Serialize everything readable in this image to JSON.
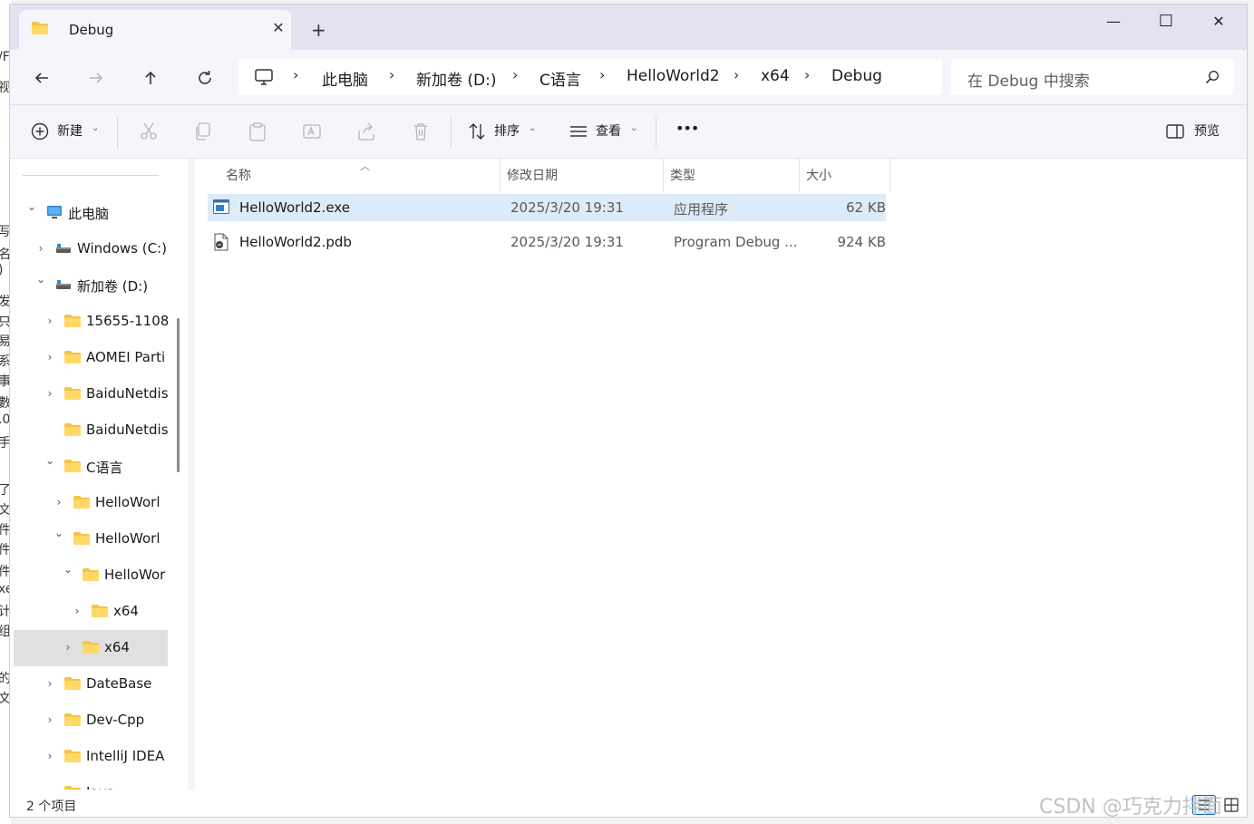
{
  "window": {
    "tab_title": "Debug",
    "new_tab": "+",
    "minimize": "—",
    "maximize": "☐",
    "close": "✕"
  },
  "address": {
    "breadcrumbs": [
      "此电脑",
      "新加卷 (D:)",
      "C语言",
      "HelloWorld2",
      "x64",
      "Debug"
    ],
    "search_placeholder": "在 Debug 中搜索"
  },
  "toolbar": {
    "new_label": "新建",
    "sort_label": "排序",
    "view_label": "查看",
    "more_label": "•••",
    "preview_label": "预览"
  },
  "nav_tree": [
    {
      "label": "此电脑",
      "icon": "pc-icon",
      "expanded": true
    },
    {
      "label": "Windows (C:)",
      "icon": "drive-icon",
      "expanded": false
    },
    {
      "label": "新加卷 (D:)",
      "icon": "drive-icon",
      "expanded": true
    },
    {
      "label": "15655-1108",
      "icon": "folder-icon",
      "expanded": false
    },
    {
      "label": "AOMEI Parti",
      "icon": "folder-icon",
      "expanded": false
    },
    {
      "label": "BaiduNetdis",
      "icon": "folder-icon",
      "expanded": false
    },
    {
      "label": "BaiduNetdis",
      "icon": "folder-icon",
      "expanded": null
    },
    {
      "label": "C语言",
      "icon": "folder-icon",
      "expanded": true
    },
    {
      "label": "HelloWorl",
      "icon": "folder-icon",
      "expanded": false
    },
    {
      "label": "HelloWorl",
      "icon": "folder-icon",
      "expanded": true
    },
    {
      "label": "HelloWor",
      "icon": "folder-icon",
      "expanded": true
    },
    {
      "label": "x64",
      "icon": "folder-icon",
      "expanded": false
    },
    {
      "label": "x64",
      "icon": "folder-icon",
      "expanded": false,
      "selected": true
    },
    {
      "label": "DateBase",
      "icon": "folder-icon",
      "expanded": false
    },
    {
      "label": "Dev-Cpp",
      "icon": "folder-icon",
      "expanded": false
    },
    {
      "label": "IntelliJ IDEA",
      "icon": "folder-icon",
      "expanded": false
    },
    {
      "label": "Java",
      "icon": "folder-icon",
      "expanded": false
    }
  ],
  "file_list": {
    "columns": [
      "名称",
      "修改日期",
      "类型",
      "大小"
    ],
    "rows": [
      {
        "name": "HelloWorld2.exe",
        "modified": "2025/3/20 19:31",
        "type": "应用程序",
        "size": "62 KB",
        "icon": "exe-icon",
        "selected": true
      },
      {
        "name": "HelloWorld2.pdb",
        "modified": "2025/3/20 19:31",
        "type": "Program Debug ...",
        "size": "924 KB",
        "icon": "pdb-file-icon",
        "selected": false
      }
    ]
  },
  "status": {
    "item_count": "2 个项目"
  },
  "watermark": "CSDN @巧克力拌面",
  "colors": {
    "titlebar_bg": "#e6e1f1",
    "toolbar_bg": "#f7f5fb",
    "selection_bg": "#dcebf9",
    "folder_yellow": "#f5c443",
    "accent_blue": "#0a64c2"
  }
}
